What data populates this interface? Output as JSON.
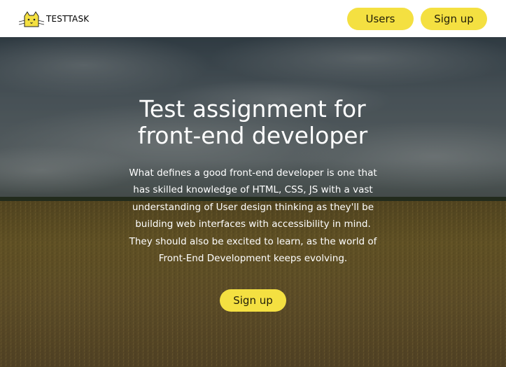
{
  "header": {
    "logo_text": "TESTTASK",
    "logo_icon": "cat-icon",
    "nav": {
      "users_label": "Users",
      "signup_label": "Sign up"
    }
  },
  "hero": {
    "title": "Test assignment for front-end developer",
    "text": "What defines a good front-end developer is one that has skilled knowledge of HTML, CSS, JS with a vast understanding of User design thinking as they'll be building web interfaces with accessibility in mind. They should also be excited to learn, as the world of Front-End Development keeps evolving.",
    "signup_label": "Sign up"
  },
  "colors": {
    "accent": "#f4e041",
    "header_bg": "#ffffff",
    "hero_text": "#ffffff"
  }
}
